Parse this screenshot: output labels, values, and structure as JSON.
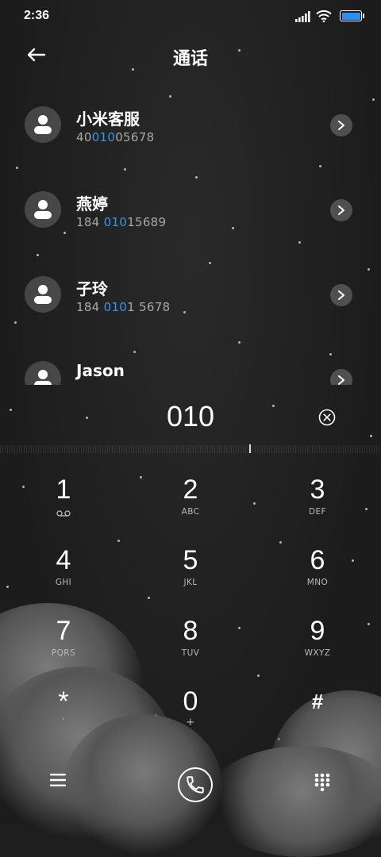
{
  "status_bar": {
    "time": "2:36"
  },
  "header": {
    "title": "通话"
  },
  "contacts": [
    {
      "name": "小米客服",
      "number_pre": "40",
      "number_match": "010",
      "number_post": "05678"
    },
    {
      "name": "燕婷",
      "number_pre": "184 ",
      "number_match": "010",
      "number_post": "15689"
    },
    {
      "name": "子玲",
      "number_pre": "184 ",
      "number_match": "010",
      "number_post": "1 5678"
    },
    {
      "name": "Jason",
      "number_pre": "",
      "number_match": "",
      "number_post": ""
    }
  ],
  "dial_input": {
    "value": "010"
  },
  "keypad": [
    {
      "digit": "1",
      "letters": "voicemail-icon"
    },
    {
      "digit": "2",
      "letters": "ABC"
    },
    {
      "digit": "3",
      "letters": "DEF"
    },
    {
      "digit": "4",
      "letters": "GHI"
    },
    {
      "digit": "5",
      "letters": "JKL"
    },
    {
      "digit": "6",
      "letters": "MNO"
    },
    {
      "digit": "7",
      "letters": "PQRS"
    },
    {
      "digit": "8",
      "letters": "TUV"
    },
    {
      "digit": "9",
      "letters": "WXYZ"
    },
    {
      "digit": "*",
      "letters": ","
    },
    {
      "digit": "0",
      "letters": "+"
    },
    {
      "digit": "#",
      "letters": ""
    }
  ],
  "colors": {
    "highlight": "#3596ea",
    "battery": "#2b8ef5"
  },
  "icons": {
    "back": "arrow-left-icon",
    "clear": "clear-circle-icon",
    "menu": "menu-icon",
    "call": "phone-icon",
    "keypad": "dialpad-icon"
  }
}
